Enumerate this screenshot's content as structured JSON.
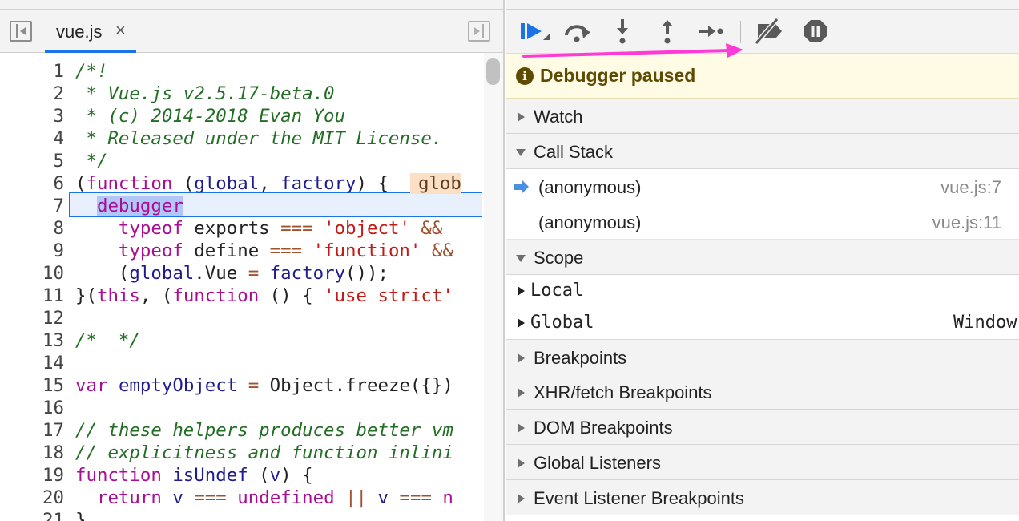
{
  "editor": {
    "tab": {
      "filename": "vue.js",
      "close_glyph": "×"
    },
    "current_line": 7,
    "lines": [
      {
        "n": "1",
        "segments": [
          {
            "t": "/*!",
            "c": "c-comment"
          }
        ]
      },
      {
        "n": "2",
        "segments": [
          {
            "t": " * Vue.js v2.5.17-beta.0",
            "c": "c-comment"
          }
        ]
      },
      {
        "n": "3",
        "segments": [
          {
            "t": " * (c) 2014-2018 Evan You",
            "c": "c-comment"
          }
        ]
      },
      {
        "n": "4",
        "segments": [
          {
            "t": " * Released under the MIT License.",
            "c": "c-comment"
          }
        ]
      },
      {
        "n": "5",
        "segments": [
          {
            "t": " */",
            "c": "c-comment"
          }
        ]
      },
      {
        "n": "6",
        "segments": [
          {
            "t": "(",
            "c": ""
          },
          {
            "t": "function",
            "c": "c-kw"
          },
          {
            "t": " (",
            "c": ""
          },
          {
            "t": "global",
            "c": "c-var"
          },
          {
            "t": ", ",
            "c": ""
          },
          {
            "t": "factory",
            "c": "c-var"
          },
          {
            "t": ") {  ",
            "c": ""
          },
          {
            "t": "glob",
            "c": "c-inline"
          }
        ]
      },
      {
        "n": "7",
        "segments": [
          {
            "t": "  ",
            "c": ""
          },
          {
            "t": "debugger",
            "c": "c-kw debugger-word"
          }
        ]
      },
      {
        "n": "8",
        "segments": [
          {
            "t": "    ",
            "c": ""
          },
          {
            "t": "typeof",
            "c": "c-kw"
          },
          {
            "t": " exports ",
            "c": ""
          },
          {
            "t": "===",
            "c": "c-op"
          },
          {
            "t": " ",
            "c": ""
          },
          {
            "t": "'object'",
            "c": "c-str"
          },
          {
            "t": " ",
            "c": ""
          },
          {
            "t": "&&",
            "c": "c-op"
          }
        ]
      },
      {
        "n": "9",
        "segments": [
          {
            "t": "    ",
            "c": ""
          },
          {
            "t": "typeof",
            "c": "c-kw"
          },
          {
            "t": " define ",
            "c": ""
          },
          {
            "t": "===",
            "c": "c-op"
          },
          {
            "t": " ",
            "c": ""
          },
          {
            "t": "'function'",
            "c": "c-str"
          },
          {
            "t": " ",
            "c": ""
          },
          {
            "t": "&&",
            "c": "c-op"
          }
        ]
      },
      {
        "n": "10",
        "segments": [
          {
            "t": "    (",
            "c": ""
          },
          {
            "t": "global",
            "c": "c-var"
          },
          {
            "t": ".Vue ",
            "c": ""
          },
          {
            "t": "=",
            "c": "c-op"
          },
          {
            "t": " ",
            "c": ""
          },
          {
            "t": "factory",
            "c": "c-var"
          },
          {
            "t": "());",
            "c": ""
          }
        ]
      },
      {
        "n": "11",
        "segments": [
          {
            "t": "}(",
            "c": ""
          },
          {
            "t": "this",
            "c": "c-kw"
          },
          {
            "t": ", (",
            "c": ""
          },
          {
            "t": "function",
            "c": "c-kw"
          },
          {
            "t": " () { ",
            "c": ""
          },
          {
            "t": "'use strict'",
            "c": "c-str"
          }
        ]
      },
      {
        "n": "12",
        "segments": []
      },
      {
        "n": "13",
        "segments": [
          {
            "t": "/*  */",
            "c": "c-comment"
          }
        ]
      },
      {
        "n": "14",
        "segments": []
      },
      {
        "n": "15",
        "segments": [
          {
            "t": "var",
            "c": "c-kw"
          },
          {
            "t": " ",
            "c": ""
          },
          {
            "t": "emptyObject",
            "c": "c-var"
          },
          {
            "t": " ",
            "c": ""
          },
          {
            "t": "=",
            "c": "c-op"
          },
          {
            "t": " Object.freeze({})",
            "c": ""
          }
        ]
      },
      {
        "n": "16",
        "segments": []
      },
      {
        "n": "17",
        "segments": [
          {
            "t": "// these helpers produces better vm",
            "c": "c-comment"
          }
        ]
      },
      {
        "n": "18",
        "segments": [
          {
            "t": "// explicitness and function inlini",
            "c": "c-comment"
          }
        ]
      },
      {
        "n": "19",
        "segments": [
          {
            "t": "function",
            "c": "c-kw"
          },
          {
            "t": " ",
            "c": ""
          },
          {
            "t": "isUndef",
            "c": "c-var"
          },
          {
            "t": " (",
            "c": ""
          },
          {
            "t": "v",
            "c": "c-var"
          },
          {
            "t": ") {",
            "c": ""
          }
        ]
      },
      {
        "n": "20",
        "segments": [
          {
            "t": "  ",
            "c": ""
          },
          {
            "t": "return",
            "c": "c-kw"
          },
          {
            "t": " ",
            "c": ""
          },
          {
            "t": "v",
            "c": "c-var"
          },
          {
            "t": " ",
            "c": ""
          },
          {
            "t": "===",
            "c": "c-op"
          },
          {
            "t": " ",
            "c": ""
          },
          {
            "t": "undefined",
            "c": "c-kw"
          },
          {
            "t": " ",
            "c": ""
          },
          {
            "t": "||",
            "c": "c-op"
          },
          {
            "t": " ",
            "c": ""
          },
          {
            "t": "v",
            "c": "c-var"
          },
          {
            "t": " ",
            "c": ""
          },
          {
            "t": "===",
            "c": "c-op"
          },
          {
            "t": " n",
            "c": "c-kw"
          }
        ]
      },
      {
        "n": "21",
        "segments": [
          {
            "t": "}",
            "c": ""
          }
        ]
      }
    ]
  },
  "toolbar": {
    "buttons": [
      {
        "name": "resume-icon",
        "color": "#1a73e8"
      },
      {
        "name": "step-over-icon",
        "color": "#5a5a5a"
      },
      {
        "name": "step-into-icon",
        "color": "#5a5a5a"
      },
      {
        "name": "step-out-icon",
        "color": "#5a5a5a"
      },
      {
        "name": "step-icon",
        "color": "#5a5a5a"
      },
      {
        "name": "deactivate-breakpoints-icon",
        "color": "#5a5a5a"
      },
      {
        "name": "pause-on-exceptions-icon",
        "color": "#5a5a5a"
      }
    ]
  },
  "annotation_color": "#ff3ad7",
  "paused_banner": {
    "icon": "i",
    "text": "Debugger paused"
  },
  "sections": {
    "watch": "Watch",
    "call_stack": "Call Stack",
    "scope": "Scope",
    "breakpoints": "Breakpoints",
    "xhr": "XHR/fetch Breakpoints",
    "dom": "DOM Breakpoints",
    "global_listeners": "Global Listeners",
    "event_listener_breakpoints": "Event Listener Breakpoints"
  },
  "call_stack": [
    {
      "name": "(anonymous)",
      "location": "vue.js:7",
      "current": true
    },
    {
      "name": "(anonymous)",
      "location": "vue.js:11",
      "current": false
    }
  ],
  "scope": [
    {
      "name": "Local",
      "value": ""
    },
    {
      "name": "Global",
      "value": "Window"
    }
  ]
}
